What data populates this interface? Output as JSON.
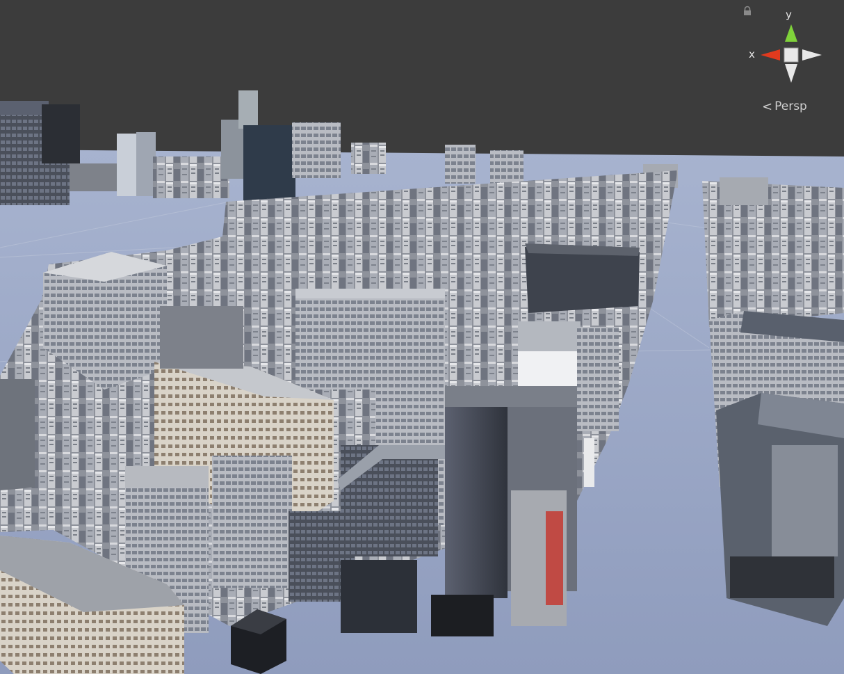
{
  "scene_view": {
    "orientation_gizmo": {
      "y_label": "y",
      "x_label": "x",
      "projection_label": "Persp",
      "projection_icon": "chevron-left-icon",
      "lock_icon": "lock-icon",
      "colors": {
        "y_axis": "#7fd23a",
        "x_axis": "#e03a1e",
        "neutral_axis": "#e8e8e8",
        "center_cube": "#e8e8e8"
      }
    },
    "colors": {
      "background": "#3c3c3c",
      "ground_plane": "#9aa6c4"
    },
    "scene_objects": [
      "city-buildings",
      "ground-plane",
      "scene-grid"
    ]
  }
}
